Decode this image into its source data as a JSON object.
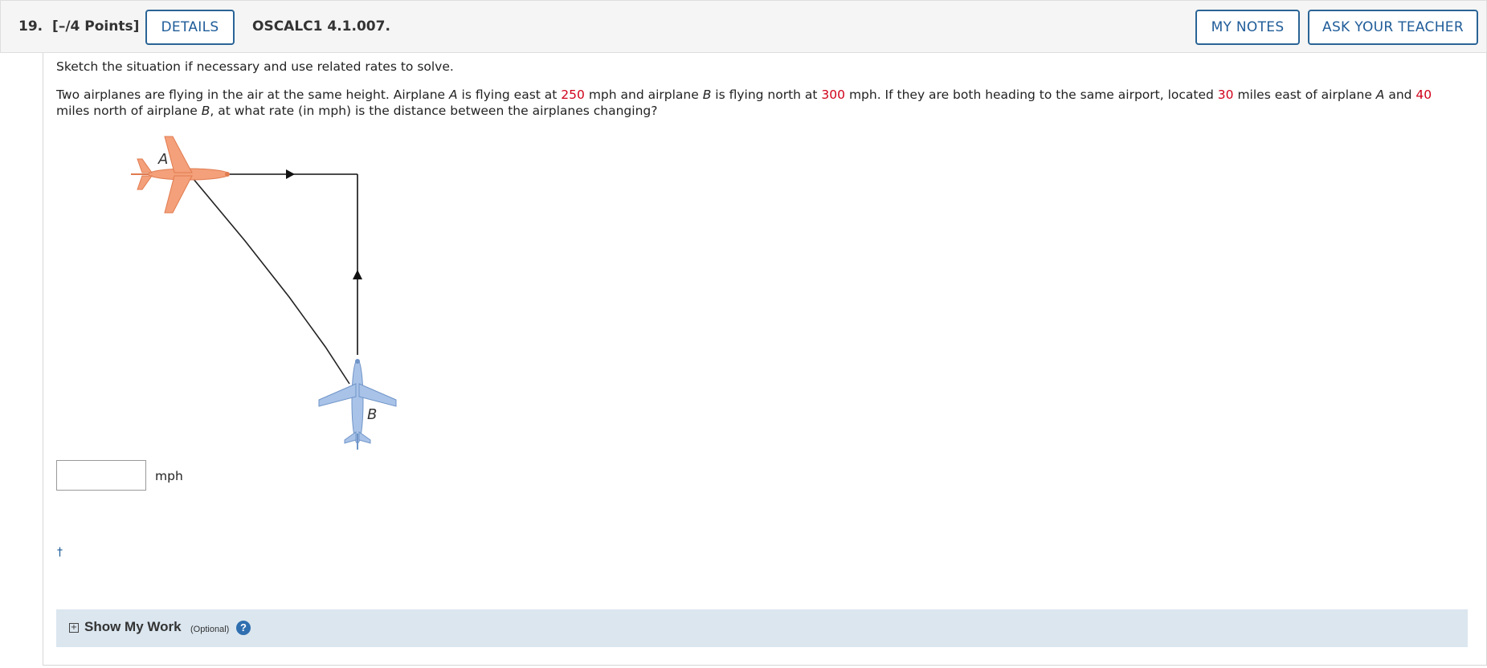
{
  "header": {
    "question_number": "19.",
    "points": "[–/4 Points]",
    "details_label": "DETAILS",
    "code": "OSCALC1 4.1.007.",
    "my_notes_label": "MY NOTES",
    "ask_teacher_label": "ASK YOUR TEACHER"
  },
  "question": {
    "instruction": "Sketch the situation if necessary and use related rates to solve.",
    "text_parts": [
      "Two airplanes are flying in the air at the same height. Airplane ",
      "A",
      " is flying east at ",
      "250",
      " mph and airplane ",
      "B",
      " is flying north at ",
      "300",
      " mph. If they are both heading to the same airport, located ",
      "30",
      " miles east of airplane ",
      "A",
      " and ",
      "40",
      " miles north of airplane ",
      "B",
      ", at what rate (in mph) is the distance between the airplanes changing?"
    ],
    "highlight_color": "#d0021b"
  },
  "diagram": {
    "label_a": "A",
    "label_b": "B",
    "plane_a_color": "#f4a07a",
    "plane_b_color": "#a9c3e8"
  },
  "answer": {
    "value": "",
    "unit": "mph"
  },
  "footnote": "†",
  "show_my_work": {
    "title": "Show My Work",
    "optional": "(Optional)",
    "help_icon": "?"
  }
}
